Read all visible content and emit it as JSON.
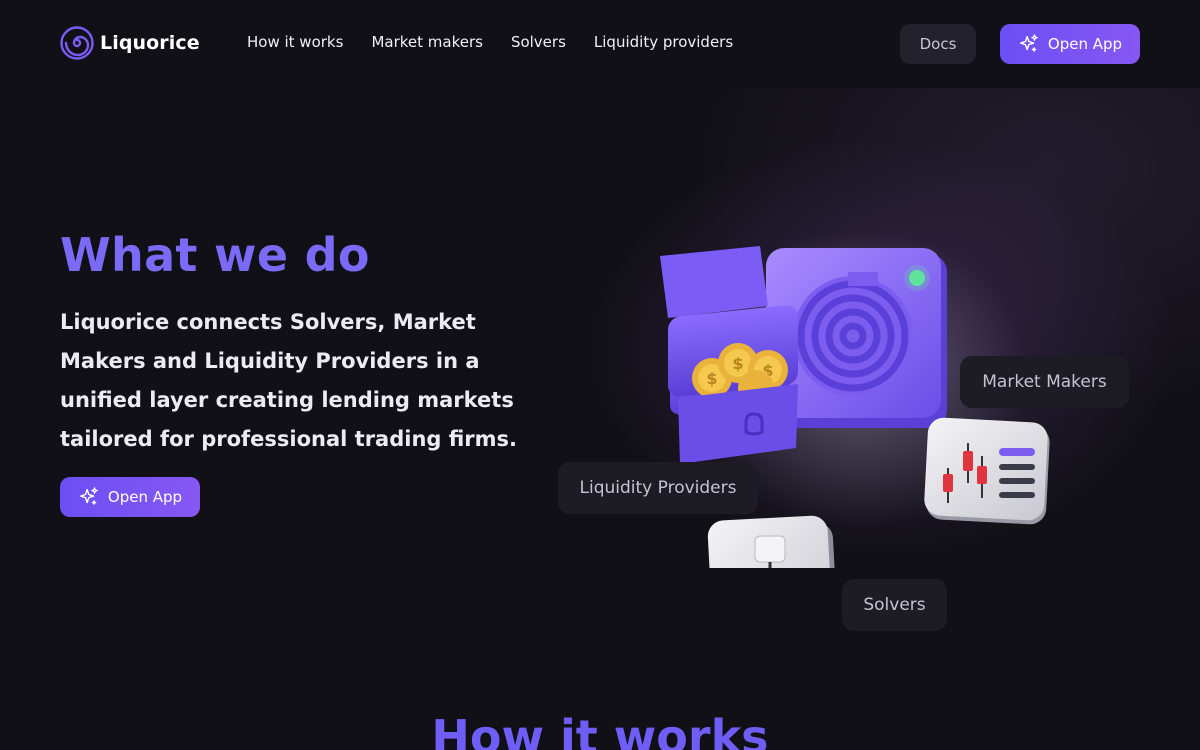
{
  "header": {
    "logo_text": "Liquorice",
    "nav": [
      "How it works",
      "Market makers",
      "Solvers",
      "Liquidity providers"
    ],
    "docs_label": "Docs",
    "open_app_label": "Open App"
  },
  "hero": {
    "title": "What we do",
    "description": "Liquorice connects Solvers, Market Makers and Liquidity Providers in a unified layer creating lending markets tailored for professional trading firms.",
    "button_label": "Open App"
  },
  "illustration": {
    "labels": {
      "market_makers": "Market Makers",
      "liquidity_providers": "Liquidity Providers",
      "solvers": "Solvers"
    }
  },
  "next_section": {
    "title": "How it works"
  },
  "colors": {
    "background": "#111016",
    "accent": "#7a6af6",
    "button": "#6b4ff5"
  }
}
